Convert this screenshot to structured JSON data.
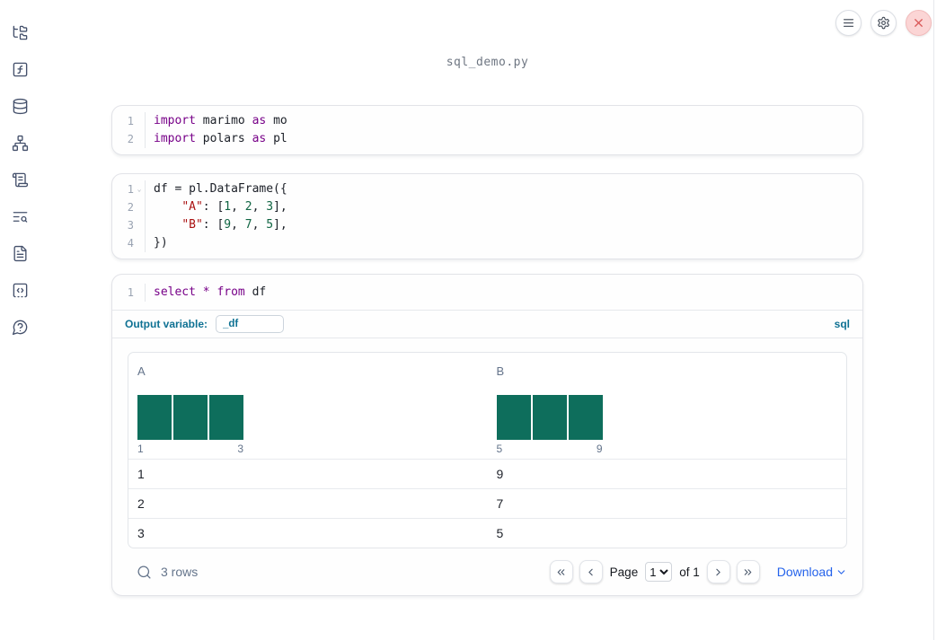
{
  "window": {
    "title": "sql_demo.py"
  },
  "sidebar": {
    "items": [
      {
        "name": "file-explorer",
        "icon": "folder-tree-icon"
      },
      {
        "name": "variables",
        "icon": "function-square-icon"
      },
      {
        "name": "data-sources",
        "icon": "database-icon"
      },
      {
        "name": "dependency-graph",
        "icon": "network-icon"
      },
      {
        "name": "scratchpad",
        "icon": "scroll-icon"
      },
      {
        "name": "logs",
        "icon": "text-search-icon"
      },
      {
        "name": "documentation",
        "icon": "file-text-icon"
      },
      {
        "name": "snippets",
        "icon": "code-snippet-icon"
      },
      {
        "name": "help",
        "icon": "help-chat-icon"
      }
    ]
  },
  "topbar": {
    "buttons": [
      {
        "name": "notebook-menu",
        "icon": "hamburger-menu-icon"
      },
      {
        "name": "settings",
        "icon": "gear-icon"
      },
      {
        "name": "shutdown",
        "icon": "close-x-icon"
      }
    ]
  },
  "cells": [
    {
      "lines": [
        {
          "num": "1",
          "tokens": [
            [
              "import",
              "kw"
            ],
            [
              " marimo ",
              "pl"
            ],
            [
              "as",
              "kw"
            ],
            [
              " mo",
              "pl"
            ]
          ]
        },
        {
          "num": "2",
          "tokens": [
            [
              "import",
              "kw"
            ],
            [
              " polars ",
              "pl"
            ],
            [
              "as",
              "kw"
            ],
            [
              " pl",
              "pl"
            ]
          ]
        }
      ]
    },
    {
      "lines": [
        {
          "num": "1",
          "fold": true,
          "tokens": [
            [
              "df = pl.DataFrame({",
              "pl"
            ]
          ]
        },
        {
          "num": "2",
          "tokens": [
            [
              "    ",
              "pl"
            ],
            [
              "\"A\"",
              "str"
            ],
            [
              ": [",
              "pl"
            ],
            [
              "1",
              "num"
            ],
            [
              ", ",
              "pl"
            ],
            [
              "2",
              "num"
            ],
            [
              ", ",
              "pl"
            ],
            [
              "3",
              "num"
            ],
            [
              "],",
              "pl"
            ]
          ]
        },
        {
          "num": "3",
          "tokens": [
            [
              "    ",
              "pl"
            ],
            [
              "\"B\"",
              "str"
            ],
            [
              ": [",
              "pl"
            ],
            [
              "9",
              "num"
            ],
            [
              ", ",
              "pl"
            ],
            [
              "7",
              "num"
            ],
            [
              ", ",
              "pl"
            ],
            [
              "5",
              "num"
            ],
            [
              "],",
              "pl"
            ]
          ]
        },
        {
          "num": "4",
          "tokens": [
            [
              "})",
              "pl"
            ]
          ]
        }
      ]
    },
    {
      "lines": [
        {
          "num": "1",
          "tokens": [
            [
              "select",
              "kw"
            ],
            [
              " ",
              "pl"
            ],
            [
              "*",
              "kw"
            ],
            [
              " ",
              "pl"
            ],
            [
              "from",
              "kw"
            ],
            [
              " df",
              "pl"
            ]
          ]
        }
      ]
    }
  ],
  "sql_cell": {
    "output_variable_label": "Output variable:",
    "output_variable_value": "_df",
    "language_badge": "sql"
  },
  "table": {
    "columns": [
      {
        "label": "A",
        "hist": {
          "bars": [
            1,
            1,
            1
          ],
          "min_label": "1",
          "max_label": "3"
        }
      },
      {
        "label": "B",
        "hist": {
          "bars": [
            1,
            1,
            1
          ],
          "min_label": "5",
          "max_label": "9"
        }
      }
    ],
    "rows": [
      [
        "1",
        "9"
      ],
      [
        "2",
        "7"
      ],
      [
        "3",
        "5"
      ]
    ],
    "footer": {
      "row_count": "3 rows",
      "page_label": "Page",
      "page_value": "1",
      "of_label": "of 1",
      "download_label": "Download"
    }
  },
  "colors": {
    "accent_blue": "#0e7193",
    "download_blue": "#2563eb",
    "histogram_bar": "#0e6e5c",
    "keyword": "#770088",
    "string": "#aa1111",
    "number": "#116644",
    "close_red": "#d95757"
  }
}
